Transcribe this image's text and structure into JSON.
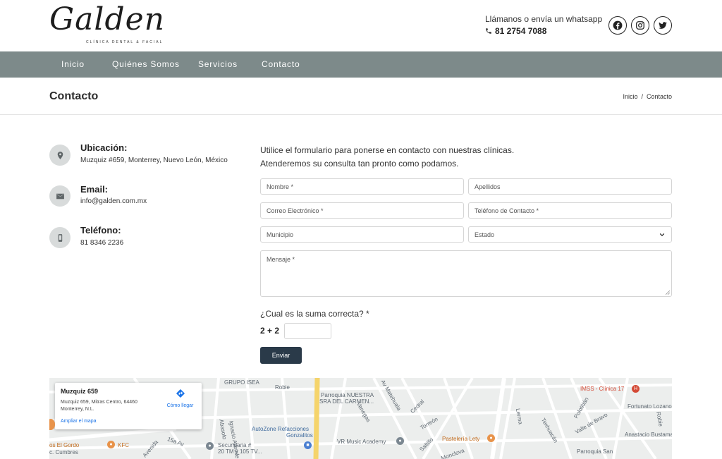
{
  "brand": {
    "name": "Galden",
    "subtitle": "CLÍNICA DENTAL & FACIAL"
  },
  "top_contact": {
    "line1": "Llámanos o envía un whatsapp",
    "phone": "81 2754 7088"
  },
  "social": [
    "facebook-icon",
    "instagram-icon",
    "twitter-icon"
  ],
  "nav": {
    "items": [
      "Inicio",
      "Quiénes Somos",
      "Servicios",
      "Contacto"
    ]
  },
  "page": {
    "title": "Contacto",
    "breadcrumb": {
      "home": "Inicio",
      "sep": "/",
      "current": "Contacto"
    }
  },
  "info": {
    "location_title": "Ubicación:",
    "location_text": "Muzquiz #659, Monterrey, Nuevo León, México",
    "email_title": "Email:",
    "email_text": "info@galden.com.mx",
    "phone_title": "Teléfono:",
    "phone_text": "81 8346 2236"
  },
  "form": {
    "intro_line1": "Utilice el formulario para ponerse en contacto con nuestras clínicas.",
    "intro_line2": "Atenderemos su consulta tan pronto como podamos.",
    "nombre_placeholder": "Nombre *",
    "apellidos_placeholder": "Apellidos",
    "correo_placeholder": "Correo Electrónico *",
    "telefono_placeholder": "Teléfono de Contacto *",
    "municipio_placeholder": "Municipio",
    "estado_selected": "Estado",
    "mensaje_placeholder": "Mensaje *",
    "captcha_question": "¿Cual es la suma correcta? *",
    "captcha_equation": "2 + 2",
    "captcha_value": "",
    "submit_label": "Enviar"
  },
  "map": {
    "card_title": "Muzquiz 659",
    "card_address": "Muzquiz 659, Mitras Centro, 64460 Monterrey, N.L.",
    "card_directions": "Cómo llegar",
    "card_enlarge": "Ampliar el mapa",
    "labels": {
      "grupo_isea": "GRUPO ISEA",
      "robie": "Robie",
      "parroquia1": "Parroquia NUESTRA",
      "parroquia1b": "SRA DEL CARMEN...",
      "imss": "IMSS - Clínica 17",
      "fortunato": "Fortunato Lozano",
      "autozone": "AutoZone Refacciones",
      "autozone_b": "Gonzalitos",
      "vr_music": "VR Music Academy",
      "pasteleria": "Pastelería Lety",
      "anastacio": "Anastacio Bustama",
      "secundaria": "Secundaria #",
      "secundaria_b": "20 TM y 105 TV...",
      "el_gordo": "os El Gordo",
      "cumbres": "c. Cumbres",
      "kfc": "KFC",
      "ignacio": "Ignacio Allende",
      "abasolo": "Abasolo",
      "av15": "15a Av",
      "avenida": "Avenida",
      "matehuala": "Av Matehuala",
      "vanegas": "Vanegas",
      "cedral": "Cedral",
      "torreon": "Torreón",
      "saltillo": "Saltillo",
      "monclova": "Monclova",
      "lerma": "Lerma",
      "cuauhtitlan": "Cuautitlán",
      "polotitlan": "Polotitlán",
      "valle": "Valle de Bravo",
      "texhuacan": "Texhuacán",
      "robie2": "Robie",
      "parroquia2": "Parroquia San"
    }
  }
}
